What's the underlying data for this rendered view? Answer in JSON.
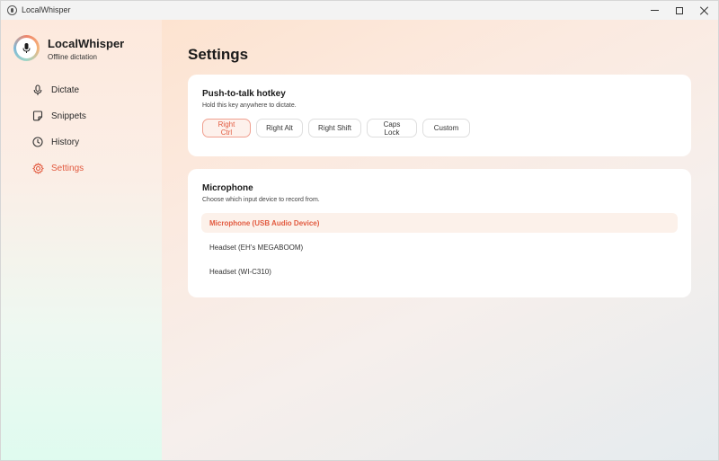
{
  "window": {
    "title": "LocalWhisper"
  },
  "brand": {
    "name": "LocalWhisper",
    "subtitle": "Offline dictation"
  },
  "nav": {
    "items": [
      {
        "label": "Dictate",
        "icon": "microphone-icon"
      },
      {
        "label": "Snippets",
        "icon": "snippet-icon"
      },
      {
        "label": "History",
        "icon": "clock-icon"
      },
      {
        "label": "Settings",
        "icon": "gear-icon",
        "active": true
      }
    ]
  },
  "page": {
    "title": "Settings"
  },
  "hotkey": {
    "title": "Push-to-talk hotkey",
    "description": "Hold this key anywhere to dictate.",
    "selected": "Right Ctrl",
    "options": [
      "Right Ctrl",
      "Right Alt",
      "Right Shift",
      "Caps Lock",
      "Custom"
    ]
  },
  "microphone": {
    "title": "Microphone",
    "description": "Choose which input device to record from.",
    "selected": "Microphone (USB Audio Device)",
    "devices": [
      "Microphone (USB Audio Device)",
      "Headset (EH's MEGABOOM)",
      "Headset (WI-C310)"
    ]
  },
  "colors": {
    "accent": "#e25a3f",
    "accent_bg": "#fdf1ec"
  }
}
